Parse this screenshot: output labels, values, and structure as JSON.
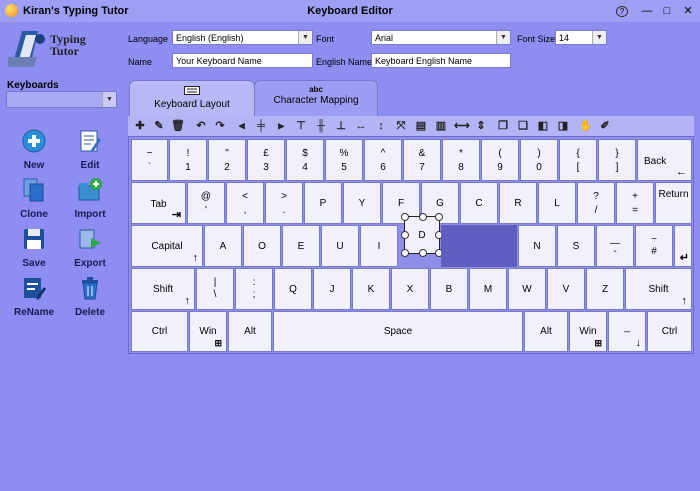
{
  "window": {
    "app_title": "Kiran's Typing Tutor",
    "title": "Keyboard  Editor",
    "help": "?",
    "minimize": "—",
    "maximize": "□",
    "close": "✕"
  },
  "logo": {
    "line1": "Typing",
    "line2": "Tutor"
  },
  "form": {
    "language_label": "Language",
    "language_value": "English    (English)",
    "font_label": "Font",
    "font_value": "Arial",
    "font_size_label": "Font Size",
    "font_size_value": "14",
    "name_label": "Name",
    "name_value": "Your Keyboard Name",
    "english_name_label": "English  Name",
    "english_name_value": "Keyboard English Name"
  },
  "sidebar": {
    "keyboards_label": "Keyboards",
    "tools": [
      {
        "label": "New"
      },
      {
        "label": "Edit"
      },
      {
        "label": "Clone"
      },
      {
        "label": "Import"
      },
      {
        "label": "Save"
      },
      {
        "label": "Export"
      },
      {
        "label": "ReName"
      },
      {
        "label": "Delete"
      }
    ]
  },
  "tabs": [
    {
      "label": "Keyboard Layout",
      "icon_text": ""
    },
    {
      "label": "Character Mapping",
      "icon_text": "abc"
    }
  ],
  "keys": {
    "r1": [
      {
        "top": "~",
        "bottom": "`"
      },
      {
        "top": "!",
        "bottom": "1"
      },
      {
        "top": "\"",
        "bottom": "2"
      },
      {
        "top": "£",
        "bottom": "3"
      },
      {
        "top": "$",
        "bottom": "4"
      },
      {
        "top": "%",
        "bottom": "5"
      },
      {
        "top": "^",
        "bottom": "6"
      },
      {
        "top": "&",
        "bottom": "7"
      },
      {
        "top": "*",
        "bottom": "8"
      },
      {
        "top": "(",
        "bottom": "9"
      },
      {
        "top": ")",
        "bottom": "0"
      },
      {
        "top": "{",
        "bottom": "["
      },
      {
        "top": "}",
        "bottom": "]"
      }
    ],
    "backspace": "Back",
    "tab": "Tab",
    "r2": [
      {
        "top": "@",
        "bottom": "'"
      },
      {
        "top": "<",
        "bottom": ","
      },
      {
        "top": ">",
        "bottom": "."
      },
      {
        "label": "P"
      },
      {
        "label": "Y"
      },
      {
        "label": "F"
      },
      {
        "label": "G"
      },
      {
        "label": "C"
      },
      {
        "label": "R"
      },
      {
        "label": "L"
      },
      {
        "top": "?",
        "bottom": "/"
      },
      {
        "top": "+",
        "bottom": "="
      }
    ],
    "return": "Return",
    "capital": "Capital",
    "r3": [
      "A",
      "O",
      "E",
      "U",
      "I",
      "D"
    ],
    "r3b": [
      "N",
      "S"
    ],
    "r3_dash": {
      "top": "—",
      "bottom": "-"
    },
    "r3_hash": {
      "top": "~",
      "bottom": "#"
    },
    "shift": "Shift",
    "r4_pipe": {
      "top": "|",
      "bottom": "\\"
    },
    "r4_colon": {
      "top": ":",
      "bottom": ";"
    },
    "r4": [
      "Q",
      "J",
      "K",
      "X",
      "B",
      "M",
      "W",
      "V",
      "Z"
    ],
    "ctrl": "Ctrl",
    "win": "Win",
    "alt": "Alt",
    "space": "Space",
    "underscore": "_"
  }
}
